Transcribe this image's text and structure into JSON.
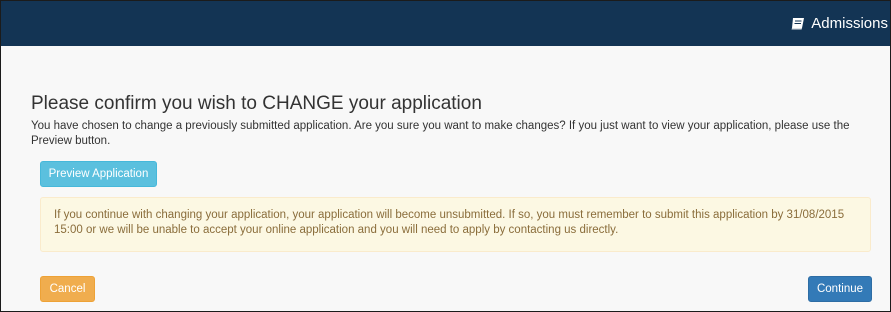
{
  "header": {
    "brand_label": "Admissions",
    "brand_icon": "book-icon",
    "background_color": "#133454"
  },
  "main": {
    "title": "Please confirm you wish to CHANGE your application",
    "intro": "You have chosen to change a previously submitted application. Are you sure you want to make changes? If you just want to view your application, please use the Preview button.",
    "preview_label": "Preview Application",
    "warning": "If you continue with changing your application, your application will become unsubmitted. If so, you must remember to submit this application by 31/08/2015 15:00 or we will be unable to accept your online application and you will need to apply by contacting us directly.",
    "cancel_label": "Cancel",
    "continue_label": "Continue"
  },
  "colors": {
    "info_button": "#5bc0de",
    "warning_button": "#f0ad4e",
    "primary_button": "#337ab7",
    "alert_background": "#fcf8e3",
    "alert_text": "#8a6d3b"
  }
}
